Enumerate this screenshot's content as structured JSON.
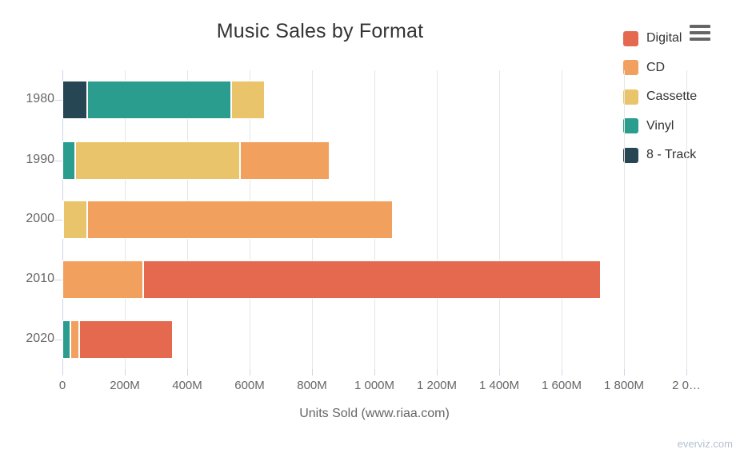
{
  "chart_data": {
    "type": "bar",
    "orientation": "horizontal",
    "stacked": true,
    "title": "Music Sales by Format",
    "xlabel": "Units Sold (www.riaa.com)",
    "ylabel": "",
    "categories": [
      "1980",
      "1990",
      "2000",
      "2010",
      "2020"
    ],
    "series": [
      {
        "name": "Digital",
        "color": "#E4694F",
        "values": [
          0,
          0,
          0,
          1465,
          300
        ]
      },
      {
        "name": "CD",
        "color": "#F2A05E",
        "values": [
          0,
          287,
          981,
          260,
          30
        ]
      },
      {
        "name": "Cassette",
        "color": "#E9C46A",
        "values": [
          110,
          530,
          76,
          0,
          0
        ]
      },
      {
        "name": "Vinyl",
        "color": "#2A9D8F",
        "values": [
          461,
          40,
          3,
          0,
          25
        ]
      },
      {
        "name": "8 - Track",
        "color": "#264653",
        "values": [
          79,
          0,
          0,
          0,
          0
        ]
      }
    ],
    "totals": [
      650,
      857,
      1060,
      1725,
      355
    ],
    "xlim": [
      0,
      2000
    ],
    "x_ticks": [
      0,
      200,
      400,
      600,
      800,
      1000,
      1200,
      1400,
      1600,
      1800,
      2000
    ],
    "x_tick_labels": [
      "0",
      "200M",
      "400M",
      "600M",
      "800M",
      "1 000M",
      "1 200M",
      "1 400M",
      "1 600M",
      "1 800M",
      "2 0…"
    ],
    "grid": true,
    "legend_position": "right",
    "credits": "everviz.com"
  },
  "menu": {
    "icon": "hamburger-menu-icon"
  }
}
